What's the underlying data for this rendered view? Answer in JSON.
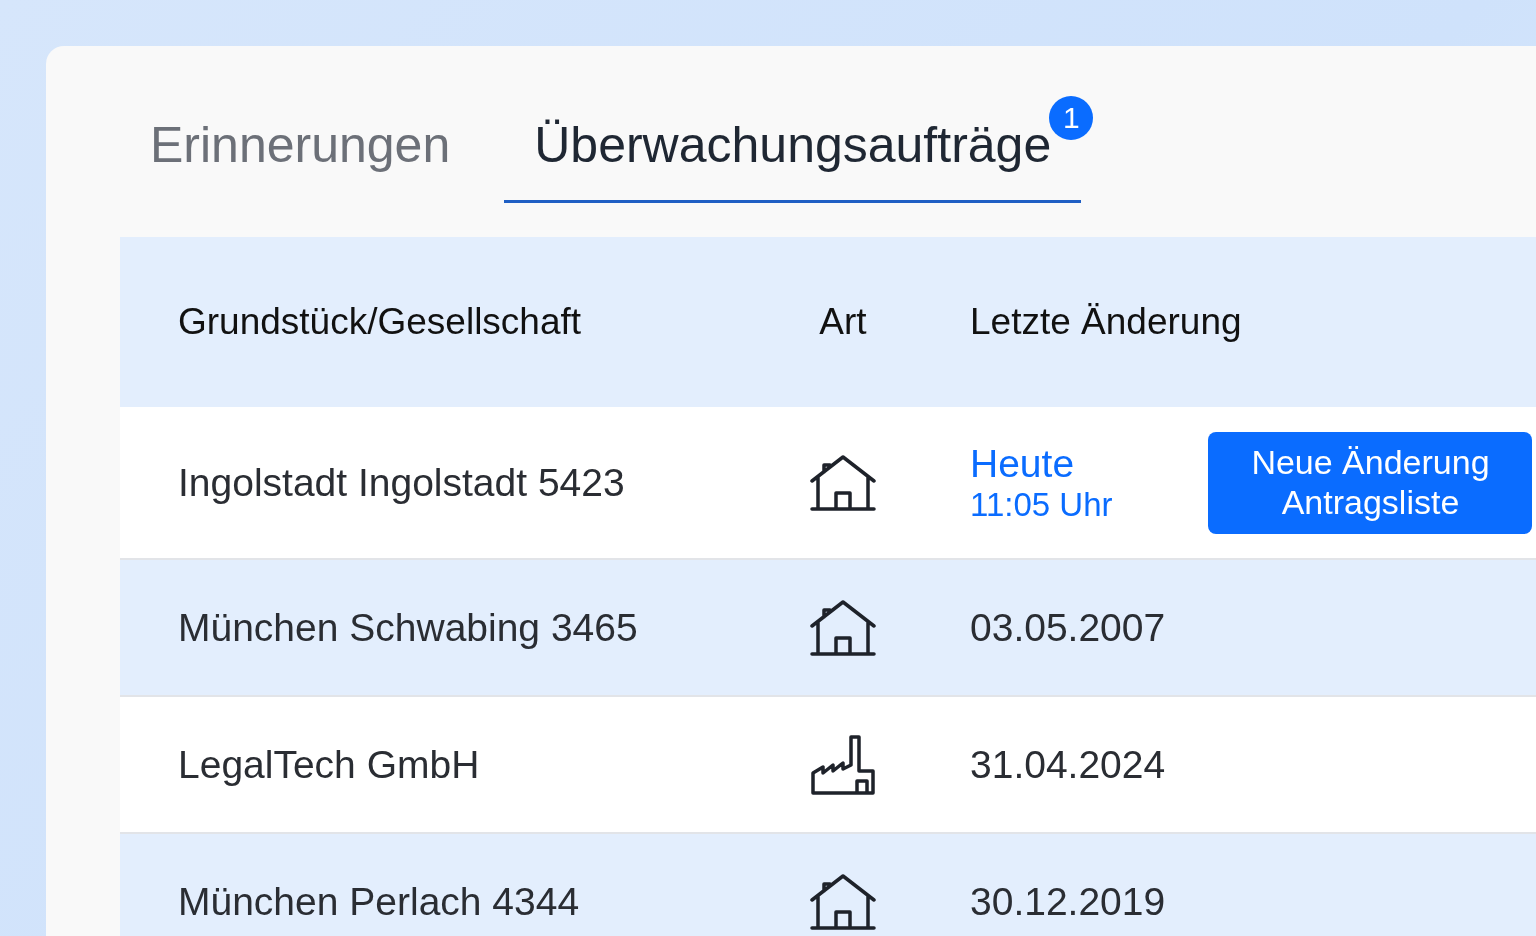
{
  "tabs": [
    {
      "label": "Erinnerungen",
      "selected": false
    },
    {
      "label": "Überwachungsaufträge",
      "selected": true,
      "badge": "1"
    }
  ],
  "table": {
    "columns": [
      "Grundstück/Gesellschaft",
      "Art",
      "Letzte Änderung"
    ],
    "rows": [
      {
        "name": "Ingolstadt Ingolstadt 5423",
        "kind": "house",
        "change": {
          "kind": "today",
          "day": "Heute",
          "time": "11:05 Uhr",
          "action": "Neue Änderung Antragsliste"
        }
      },
      {
        "name": "München Schwabing 3465",
        "kind": "house",
        "change": {
          "kind": "date",
          "day": "03.05.2007"
        }
      },
      {
        "name": "LegalTech GmbH",
        "kind": "factory",
        "change": {
          "kind": "date",
          "day": "31.04.2024"
        }
      },
      {
        "name": "München Perlach 4344",
        "kind": "house",
        "change": {
          "kind": "date",
          "day": "30.12.2019"
        }
      }
    ]
  }
}
